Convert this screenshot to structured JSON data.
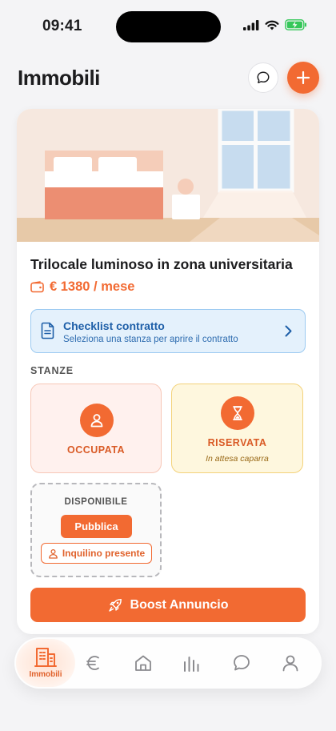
{
  "status_bar": {
    "time": "09:41"
  },
  "header": {
    "title": "Immobili"
  },
  "listing": {
    "title": "Trilocale luminoso in zona universitaria",
    "price": "€ 1380 / mese"
  },
  "checklist": {
    "title": "Checklist contratto",
    "subtitle": "Seleziona una stanza per aprire il contratto"
  },
  "rooms": {
    "heading": "STANZE",
    "occupied": {
      "label": "OCCUPATA"
    },
    "reserved": {
      "label": "RISERVATA",
      "note": "In attesa caparra"
    },
    "available": {
      "label": "DISPONIBILE",
      "publish_label": "Pubblica",
      "tenant_label": "Inquilino presente"
    }
  },
  "boost": {
    "label": "Boost Annuncio"
  },
  "tab_bar": {
    "items": [
      {
        "icon": "building-icon",
        "label": "Immobili",
        "active": true
      },
      {
        "icon": "euro-icon",
        "label": ""
      },
      {
        "icon": "home-icon",
        "label": ""
      },
      {
        "icon": "bar-chart-icon",
        "label": ""
      },
      {
        "icon": "chat-icon",
        "label": ""
      },
      {
        "icon": "user-icon",
        "label": ""
      }
    ]
  },
  "colors": {
    "accent": "#f26a32",
    "info_bg": "#e4f1fc",
    "info_text": "#1e5fa8",
    "occupied_bg": "#fff1ee",
    "reserved_bg": "#fef7de",
    "battery": "#35c759"
  }
}
